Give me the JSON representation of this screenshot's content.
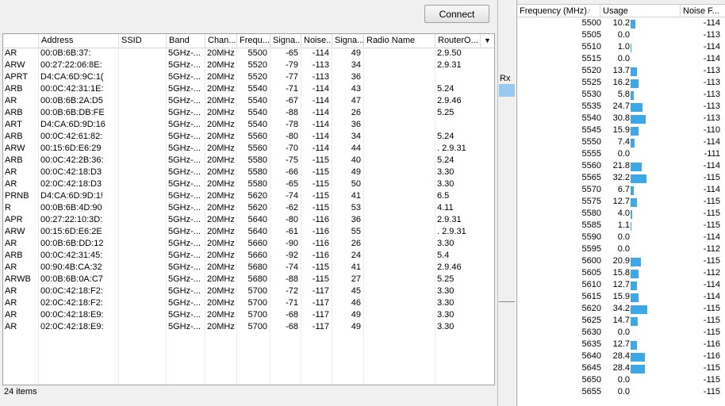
{
  "left_panel": {
    "connect_label": "Connect",
    "columns": [
      "",
      "Address",
      "SSID",
      "Band",
      "Chan...",
      "Frequ...",
      "Signa...",
      "Noise...",
      "Signa...",
      "Radio Name",
      "RouterO..."
    ],
    "dropdown_icon": "triangle-down-icon",
    "rows": [
      [
        "AR",
        "00:0B:6B:37:",
        "",
        "5GHz-...",
        "20MHz",
        "5500",
        "-65",
        "-114",
        "49",
        "",
        "2.9.50"
      ],
      [
        "ARW",
        "00:27:22:06:8E:",
        "",
        "5GHz-...",
        "20MHz",
        "5520",
        "-79",
        "-113",
        "34",
        "",
        "2.9.31"
      ],
      [
        "APRT",
        "D4:CA:6D:9C:1(",
        "",
        "5GHz-...",
        "20MHz",
        "5520",
        "-77",
        "-113",
        "36",
        "",
        ""
      ],
      [
        "ARB",
        "00:0C:42:31:1E:",
        "",
        "5GHz-...",
        "20MHz",
        "5540",
        "-71",
        "-114",
        "43",
        "",
        "5.24"
      ],
      [
        "AR",
        "00:0B:6B:2A:D5",
        "",
        "5GHz-...",
        "20MHz",
        "5540",
        "-67",
        "-114",
        "47",
        "",
        "2.9.46"
      ],
      [
        "ARB",
        "00:0B:6B:DB:FE",
        "",
        "5GHz-...",
        "20MHz",
        "5540",
        "-88",
        "-114",
        "26",
        "",
        "5.25"
      ],
      [
        "ART",
        "D4:CA:6D:9D:16",
        "",
        "5GHz-...",
        "20MHz",
        "5540",
        "-78",
        "-114",
        "36",
        "",
        ""
      ],
      [
        "ARB",
        "00:0C:42:61:82:",
        "",
        "5GHz-...",
        "20MHz",
        "5560",
        "-80",
        "-114",
        "34",
        "",
        "5.24"
      ],
      [
        "ARW",
        "00:15:6D:E6:29",
        "",
        "5GHz-...",
        "20MHz",
        "5560",
        "-70",
        "-114",
        "44",
        "",
        ". 2.9.31"
      ],
      [
        "ARB",
        "00:0C:42:2B:36:",
        "",
        "5GHz-...",
        "20MHz",
        "5580",
        "-75",
        "-115",
        "40",
        "",
        "5.24"
      ],
      [
        "AR",
        "00:0C:42:18:D3",
        "",
        "5GHz-...",
        "20MHz",
        "5580",
        "-66",
        "-115",
        "49",
        "",
        "3.30"
      ],
      [
        "AR",
        "02:0C:42:18:D3",
        "",
        "5GHz-...",
        "20MHz",
        "5580",
        "-65",
        "-115",
        "50",
        "",
        "3.30"
      ],
      [
        "PRNB",
        "D4:CA:6D:9D:1!",
        "",
        "5GHz-...",
        "20MHz",
        "5620",
        "-74",
        "-115",
        "41",
        "",
        "6.5"
      ],
      [
        "R",
        "00:0B:6B:4D:90",
        "",
        "5GHz-...",
        "20MHz",
        "5620",
        "-62",
        "-115",
        "53",
        "",
        "4.11"
      ],
      [
        "APR",
        "00:27:22:10:3D:",
        "",
        "5GHz-...",
        "20MHz",
        "5640",
        "-80",
        "-116",
        "36",
        "",
        "2.9.31"
      ],
      [
        "ARW",
        "00:15:6D:E6:2E",
        "",
        "5GHz-...",
        "20MHz",
        "5640",
        "-61",
        "-116",
        "55",
        "",
        ". 2.9.31"
      ],
      [
        "AR",
        "00:0B:6B:DD:12",
        "",
        "5GHz-...",
        "20MHz",
        "5660",
        "-90",
        "-116",
        "26",
        "",
        "3.30"
      ],
      [
        "ARB",
        "00:0C:42:31:45:",
        "",
        "5GHz-...",
        "20MHz",
        "5660",
        "-92",
        "-116",
        "24",
        "",
        "5.4"
      ],
      [
        "AR",
        "00:90:4B:CA:32",
        "",
        "5GHz-...",
        "20MHz",
        "5680",
        "-74",
        "-115",
        "41",
        "",
        "2.9.46"
      ],
      [
        "ARWB",
        "00:0B:6B:0A:C7",
        "",
        "5GHz-...",
        "20MHz",
        "5680",
        "-88",
        "-115",
        "27",
        "",
        "5.25"
      ],
      [
        "AR",
        "00:0C:42:18:F2:",
        "",
        "5GHz-...",
        "20MHz",
        "5700",
        "-72",
        "-117",
        "45",
        "",
        "3.30"
      ],
      [
        "AR",
        "02:0C:42:18:F2:",
        "",
        "5GHz-...",
        "20MHz",
        "5700",
        "-71",
        "-117",
        "46",
        "",
        "3.30"
      ],
      [
        "AR",
        "00:0C:42:18:E9:",
        "",
        "5GHz-...",
        "20MHz",
        "5700",
        "-68",
        "-117",
        "49",
        "",
        "3.30"
      ],
      [
        "AR",
        "02:0C:42:18:E9:",
        "",
        "5GHz-...",
        "20MHz",
        "5700",
        "-68",
        "-117",
        "49",
        "",
        "3.30"
      ]
    ],
    "status": "24 items"
  },
  "middle": {
    "rx_label": "Rx"
  },
  "right_panel": {
    "columns": [
      "Frequency (MHz)",
      "Usage",
      "Noise F..."
    ],
    "sort_icon": "sort-indicator-icon",
    "accent_color": "#3da8e8",
    "rows": [
      [
        "5500",
        "10.2",
        "-114"
      ],
      [
        "5505",
        "0.0",
        "-113"
      ],
      [
        "5510",
        "1.0",
        "-114"
      ],
      [
        "5515",
        "0.0",
        "-114"
      ],
      [
        "5520",
        "13.7",
        "-113"
      ],
      [
        "5525",
        "16.2",
        "-113"
      ],
      [
        "5530",
        "5.8",
        "-113"
      ],
      [
        "5535",
        "24.7",
        "-113"
      ],
      [
        "5540",
        "30.8",
        "-113"
      ],
      [
        "5545",
        "15.9",
        "-110"
      ],
      [
        "5550",
        "7.4",
        "-114"
      ],
      [
        "5555",
        "0.0",
        "-111"
      ],
      [
        "5560",
        "21.8",
        "-114"
      ],
      [
        "5565",
        "32.2",
        "-115"
      ],
      [
        "5570",
        "6.7",
        "-114"
      ],
      [
        "5575",
        "12.7",
        "-115"
      ],
      [
        "5580",
        "4.0",
        "-115"
      ],
      [
        "5585",
        "1.1",
        "-115"
      ],
      [
        "5590",
        "0.0",
        "-114"
      ],
      [
        "5595",
        "0.0",
        "-112"
      ],
      [
        "5600",
        "20.9",
        "-115"
      ],
      [
        "5605",
        "15.8",
        "-112"
      ],
      [
        "5610",
        "12.7",
        "-114"
      ],
      [
        "5615",
        "15.9",
        "-114"
      ],
      [
        "5620",
        "34.2",
        "-115"
      ],
      [
        "5625",
        "14.7",
        "-115"
      ],
      [
        "5630",
        "0.0",
        "-115"
      ],
      [
        "5635",
        "12.7",
        "-116"
      ],
      [
        "5640",
        "28.4",
        "-116"
      ],
      [
        "5645",
        "28.4",
        "-115"
      ],
      [
        "5650",
        "0.0",
        "-115"
      ],
      [
        "5655",
        "0.0",
        "-115"
      ]
    ]
  }
}
